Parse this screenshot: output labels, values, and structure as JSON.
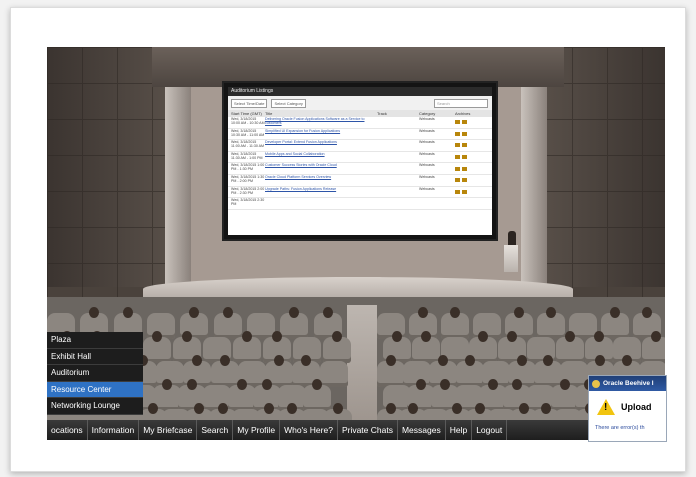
{
  "nav_list": [
    {
      "label": "Plaza",
      "active": false
    },
    {
      "label": "Exhibit Hall",
      "active": false
    },
    {
      "label": "Auditorium",
      "active": false
    },
    {
      "label": "Resource Center",
      "active": true
    },
    {
      "label": "Networking Lounge",
      "active": false
    }
  ],
  "menubar": [
    {
      "label": "ocations"
    },
    {
      "label": "Information"
    },
    {
      "label": "My Briefcase"
    },
    {
      "label": "Search"
    },
    {
      "label": "My Profile"
    },
    {
      "label": "Who's Here?"
    },
    {
      "label": "Private Chats"
    },
    {
      "label": "Messages"
    },
    {
      "label": "Help"
    },
    {
      "label": "Logout"
    }
  ],
  "popup": {
    "title": "Oracle Beehive I",
    "heading": "Upload",
    "message": "There are error(s) th"
  },
  "screen": {
    "title": "Auditorium Listings",
    "filter_time": "Select Time/Date",
    "filter_category": "Select Category",
    "search_placeholder": "Search",
    "columns": [
      "Start Time (GMT)",
      "Title",
      "Track",
      "Category",
      "Archives"
    ],
    "rows": [
      {
        "time": "Wed, 3/18/2015 10:00 AM - 10:30 AM",
        "title": "Delivering Oracle Fusion Applications Software as a Service to customers",
        "track": "",
        "category": "Webcasts"
      },
      {
        "time": "Wed, 3/18/2015 10:30 AM - 11:00 AM",
        "title": "Simplified UI Expansion for Fusion Applications",
        "track": "",
        "category": "Webcasts"
      },
      {
        "time": "Wed, 3/18/2015 11:00 AM - 11:30 AM",
        "title": "Developer Portal: Extend Fusion Applications",
        "track": "",
        "category": "Webcasts"
      },
      {
        "time": "Wed, 3/18/2015 11:30 AM - 1:00 PM",
        "title": "Mobile Apps and Social Collaboration",
        "track": "",
        "category": "Webcasts"
      },
      {
        "time": "Wed, 3/18/2015 1:00 PM - 1:30 PM",
        "title": "Customer Success Stories with Oracle Cloud",
        "track": "",
        "category": "Webcasts"
      },
      {
        "time": "Wed, 3/18/2015 1:30 PM - 2:00 PM",
        "title": "Oracle Cloud Platform Services Overview",
        "track": "",
        "category": "Webcasts"
      },
      {
        "time": "Wed, 3/18/2015 2:00 PM - 2:30 PM",
        "title": "Upgrade Paths: Fusion Applications Release",
        "track": "",
        "category": "Webcasts"
      },
      {
        "time": "Wed, 3/18/2015 2:30 PM",
        "title": "",
        "track": "",
        "category": ""
      }
    ]
  },
  "colors": {
    "nav_bg": "#1d1d1d",
    "nav_active": "#2f72c4",
    "menubar_bg": "#2a2a2a",
    "popup_title_bg": "#2f5aa4",
    "warning": "#f1c40f"
  }
}
